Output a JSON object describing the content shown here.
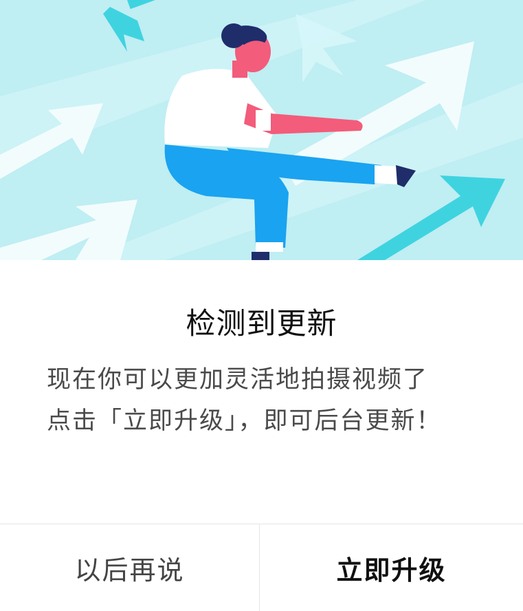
{
  "dialog": {
    "title": "检测到更新",
    "message_line1": "现在你可以更加灵活地拍摄视频了",
    "message_line2": "点击「立即升级」，即可后台更新！",
    "buttons": {
      "later_label": "以后再说",
      "upgrade_label": "立即升级"
    }
  },
  "banner": {
    "illustration": "person-riding-arrow-illustration",
    "colors": {
      "background": "#bfeef3",
      "arrow_light": "#e8f9fb",
      "arrow_accent": "#3fd3e0",
      "shirt": "#ffffff",
      "skin": "#f35c7a",
      "pants": "#1aa3f0",
      "hair": "#1f2d6b"
    }
  }
}
